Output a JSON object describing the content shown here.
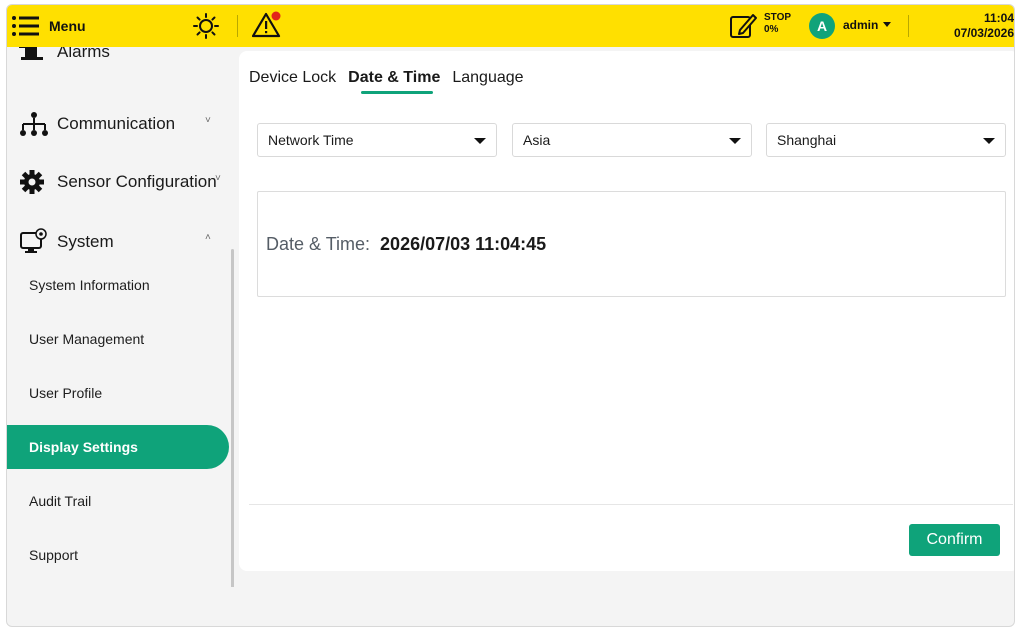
{
  "topbar": {
    "menu_label": "Menu",
    "icons": {
      "menu": "hamburger-icon",
      "brightness": "sun-icon",
      "warning": "warning-triangle-icon",
      "stop": "edit-note-icon"
    },
    "stop_label": "STOP",
    "stop_progress": "0%",
    "avatar_letter": "A",
    "user_name": "admin",
    "time": "11:04",
    "date": "07/03/2026",
    "colors": {
      "bar": "#ffe000",
      "accent": "#0fa37a",
      "alert_dot": "#e2231a"
    }
  },
  "sidebar": {
    "partial_item": "Alarms",
    "groups": [
      {
        "label": "Communication",
        "icon": "network-icon",
        "chevron": "˅"
      },
      {
        "label": "Sensor Configuration",
        "icon": "gear-icon",
        "chevron": "˅"
      },
      {
        "label": "System",
        "icon": "monitor-settings-icon",
        "chevron": "˄"
      }
    ],
    "items": [
      {
        "label": "System Information"
      },
      {
        "label": "User Management"
      },
      {
        "label": "User Profile"
      },
      {
        "label": "Display Settings",
        "active": true
      },
      {
        "label": "Audit Trail"
      },
      {
        "label": "Support"
      }
    ]
  },
  "main": {
    "tabs": [
      {
        "label": "Device Lock"
      },
      {
        "label": "Date & Time",
        "active": true
      },
      {
        "label": "Language"
      }
    ],
    "selects": [
      {
        "value": "Network Time"
      },
      {
        "value": "Asia"
      },
      {
        "value": "Shanghai"
      }
    ],
    "datetime_label": "Date & Time:",
    "datetime_value": "2026/07/03 11:04:45",
    "confirm_label": "Confirm"
  }
}
